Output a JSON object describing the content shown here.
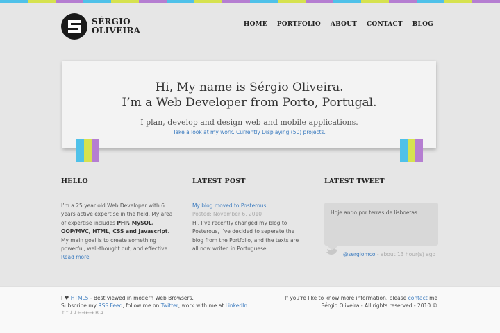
{
  "colors": {
    "cyan": "#4fc1e9",
    "lime": "#d6e24f",
    "purple": "#b57ed1",
    "link": "#3b7bbf"
  },
  "top_stripe": [
    "cyan",
    "lime",
    "purple",
    "cyan",
    "lime",
    "purple",
    "cyan",
    "lime",
    "purple",
    "cyan",
    "lime",
    "purple",
    "cyan",
    "lime",
    "purple",
    "cyan",
    "lime",
    "purple"
  ],
  "header": {
    "logo_icon": "logo-mark-icon",
    "logo_line1": "SÉRGIO",
    "logo_line2": "OLIVEIRA",
    "nav": [
      "HOME",
      "PORTFOLIO",
      "ABOUT",
      "CONTACT",
      "BLOG"
    ]
  },
  "hero": {
    "line1": "Hi, My name is Sérgio Oliveira.",
    "line2": "I’m a Web Developer from Porto, Portugal.",
    "tagline": "I plan, develop and design web and mobile applications.",
    "link": "Take a look at my work. Currently Displaying (50) projects."
  },
  "hello": {
    "title": "HELLO",
    "t1": "I’m a 25 year old Web Developer with 6 years active expertise in the field. My area of expertise includes ",
    "b1": "PHP, MySQL, OOP/MVC, HTML, CSS and Javascript",
    "t2": ". My main goal is to create something powerful, well-thought out, and effective. ",
    "more": "Read more"
  },
  "latest_post": {
    "title": "LATEST POST",
    "post_title": "My blog moved to Posterous",
    "date": "Posted: November 6, 2010",
    "body": "Hi. I’ve recently changed my blog to Posterous, I’ve decided to seperate the blog from the Portfolio, and the texts are all now writen in Portuguese."
  },
  "latest_tweet": {
    "title": "LATEST TWEET",
    "text": "Hoje ando por terras de lisboetas..",
    "icon": "twitter-bird-icon",
    "handle": "@sergiomco",
    "time": "- about 13 hour(s) ago"
  },
  "footer": {
    "l1_pre": "I ♥ ",
    "l1_link": "HTML5",
    "l1_post": " - Best viewed in modern Web Browsers.",
    "l2_pre": "Subscribe my ",
    "l2_rss": "RSS Feed",
    "l2_mid1": ", follow me on ",
    "l2_twitter": "Twitter",
    "l2_mid2": ", work with me at ",
    "l2_linkedin": "LinkedIn",
    "l3": "↑↑↓↓←→←→ B A",
    "r1_pre": "If you’re like to know more information, please ",
    "r1_link": "contact",
    "r1_post": " me",
    "r2": "Sérgio Oliveira - All rights reserved - 2010 ©"
  }
}
